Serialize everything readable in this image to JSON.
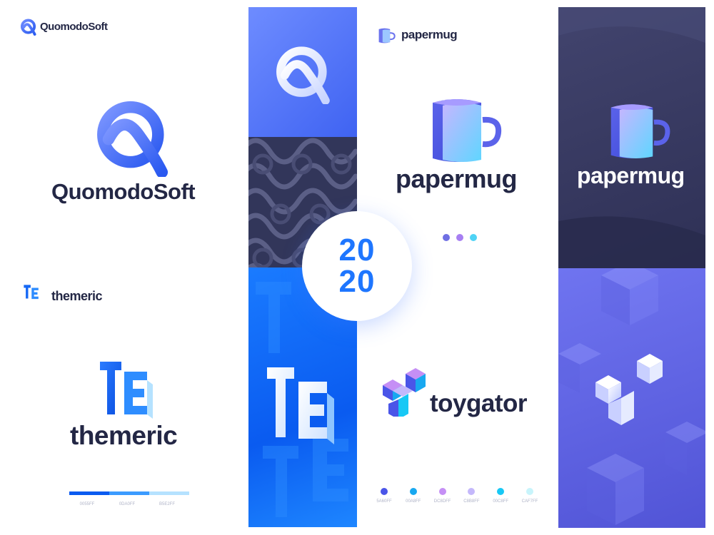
{
  "brands": {
    "quomodosoft": {
      "small_name": "QuomodoSoft",
      "large_name": "QuomodoSoft"
    },
    "themeric": {
      "small_name": "themeric",
      "large_name": "themeric"
    },
    "papermug": {
      "small_name": "papermug",
      "large_name": "papermug",
      "dark_name": "papermug"
    },
    "toygator": {
      "name": "toygator"
    }
  },
  "badge": {
    "line1": "20",
    "line2": "20"
  },
  "themeric_palette": [
    {
      "hex": "0055FF",
      "color": "#0a5bf0"
    },
    {
      "hex": "0DA0FF",
      "color": "#3b9bff"
    },
    {
      "hex": "B5E2FF",
      "color": "#b5e2ff"
    }
  ],
  "papermug_dots": [
    {
      "color": "#6f6fe3"
    },
    {
      "color": "#a77ff2"
    },
    {
      "color": "#4fd3f5"
    }
  ],
  "toygator_palette": [
    {
      "hex": "5A60FF",
      "color": "#4a55e8"
    },
    {
      "hex": "00A8FF",
      "color": "#18a8f0"
    },
    {
      "hex": "DC8DFF",
      "color": "#c58ff5"
    },
    {
      "hex": "C8B8FF",
      "color": "#c4b8fb"
    },
    {
      "hex": "00C8FF",
      "color": "#17c8f5"
    },
    {
      "hex": "CAF7FF",
      "color": "#c8f4fb"
    }
  ]
}
